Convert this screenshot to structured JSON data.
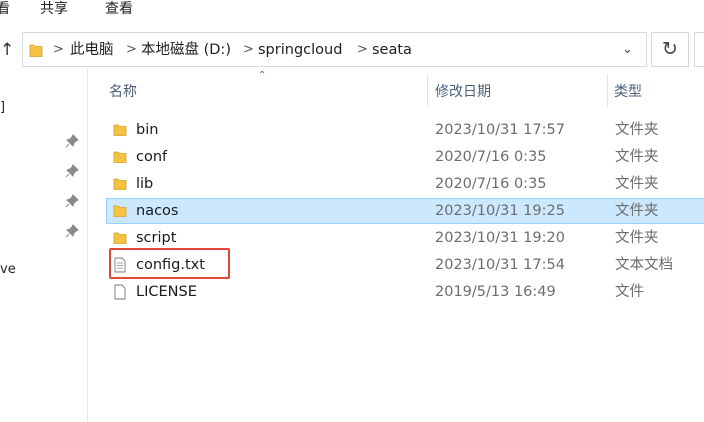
{
  "ribbon": {
    "tabs": [
      "看",
      "共享",
      "查看"
    ]
  },
  "address": {
    "crumbs": [
      "此电脑",
      "本地磁盘 (D:)",
      "springcloud",
      "seata"
    ],
    "separator": ">"
  },
  "nav_fragments": [
    "]",
    "ve"
  ],
  "columns": {
    "name": "名称",
    "date": "修改日期",
    "type": "类型"
  },
  "files": [
    {
      "name": "bin",
      "date": "2023/10/31 17:57",
      "type": "文件夹",
      "icon": "folder-icon"
    },
    {
      "name": "conf",
      "date": "2020/7/16 0:35",
      "type": "文件夹",
      "icon": "folder-icon"
    },
    {
      "name": "lib",
      "date": "2020/7/16 0:35",
      "type": "文件夹",
      "icon": "folder-icon"
    },
    {
      "name": "nacos",
      "date": "2023/10/31 19:25",
      "type": "文件夹",
      "icon": "folder-icon",
      "selected": true
    },
    {
      "name": "script",
      "date": "2023/10/31 19:20",
      "type": "文件夹",
      "icon": "folder-icon"
    },
    {
      "name": "config.txt",
      "date": "2023/10/31 17:54",
      "type": "文本文档",
      "icon": "text-file-icon",
      "highlighted": true
    },
    {
      "name": "LICENSE",
      "date": "2019/5/13 16:49",
      "type": "文件",
      "icon": "blank-file-icon"
    }
  ],
  "colors": {
    "selection": "#cce8ff",
    "highlight_box": "#e0463a",
    "folder": "#f5c242"
  }
}
